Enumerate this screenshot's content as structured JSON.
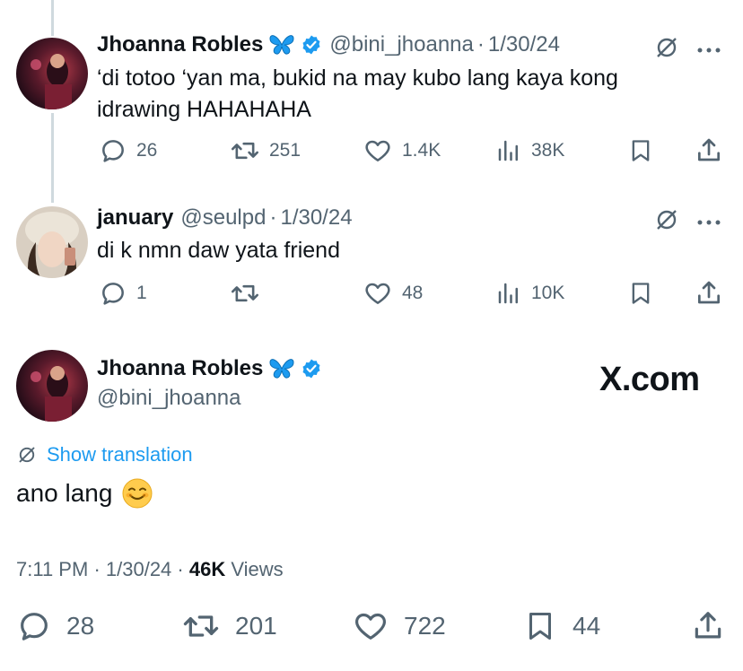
{
  "tweets": [
    {
      "name": "Jhoanna Robles",
      "handle": "@bini_jhoanna",
      "date": "1/30/24",
      "text_line1": "‘di totoo ‘yan ma, bukid na may kubo lang kaya kong",
      "text_line2": "idrawing HAHAHAHA",
      "replies": "26",
      "retweets": "251",
      "likes": "1.4K",
      "views": "38K"
    },
    {
      "name": "january",
      "handle": "@seulpd",
      "date": "1/30/24",
      "text_line1": "di k nmn daw yata friend",
      "replies": "1",
      "retweets": "",
      "likes": "48",
      "views": "10K"
    }
  ],
  "main_tweet": {
    "name": "Jhoanna Robles",
    "handle": "@bini_jhoanna",
    "brand": "X.com",
    "show_translation": "Show translation",
    "text": "ano lang",
    "emoji": "☺️",
    "time": "7:11 PM",
    "date": "1/30/24",
    "views_count": "46K",
    "views_label": "Views",
    "replies": "28",
    "retweets": "201",
    "likes": "722",
    "bookmarks": "44"
  },
  "colors": {
    "accent": "#1d9bf0",
    "muted": "#536471",
    "text": "#0f1419",
    "butterfly": "#1d9bf0"
  }
}
